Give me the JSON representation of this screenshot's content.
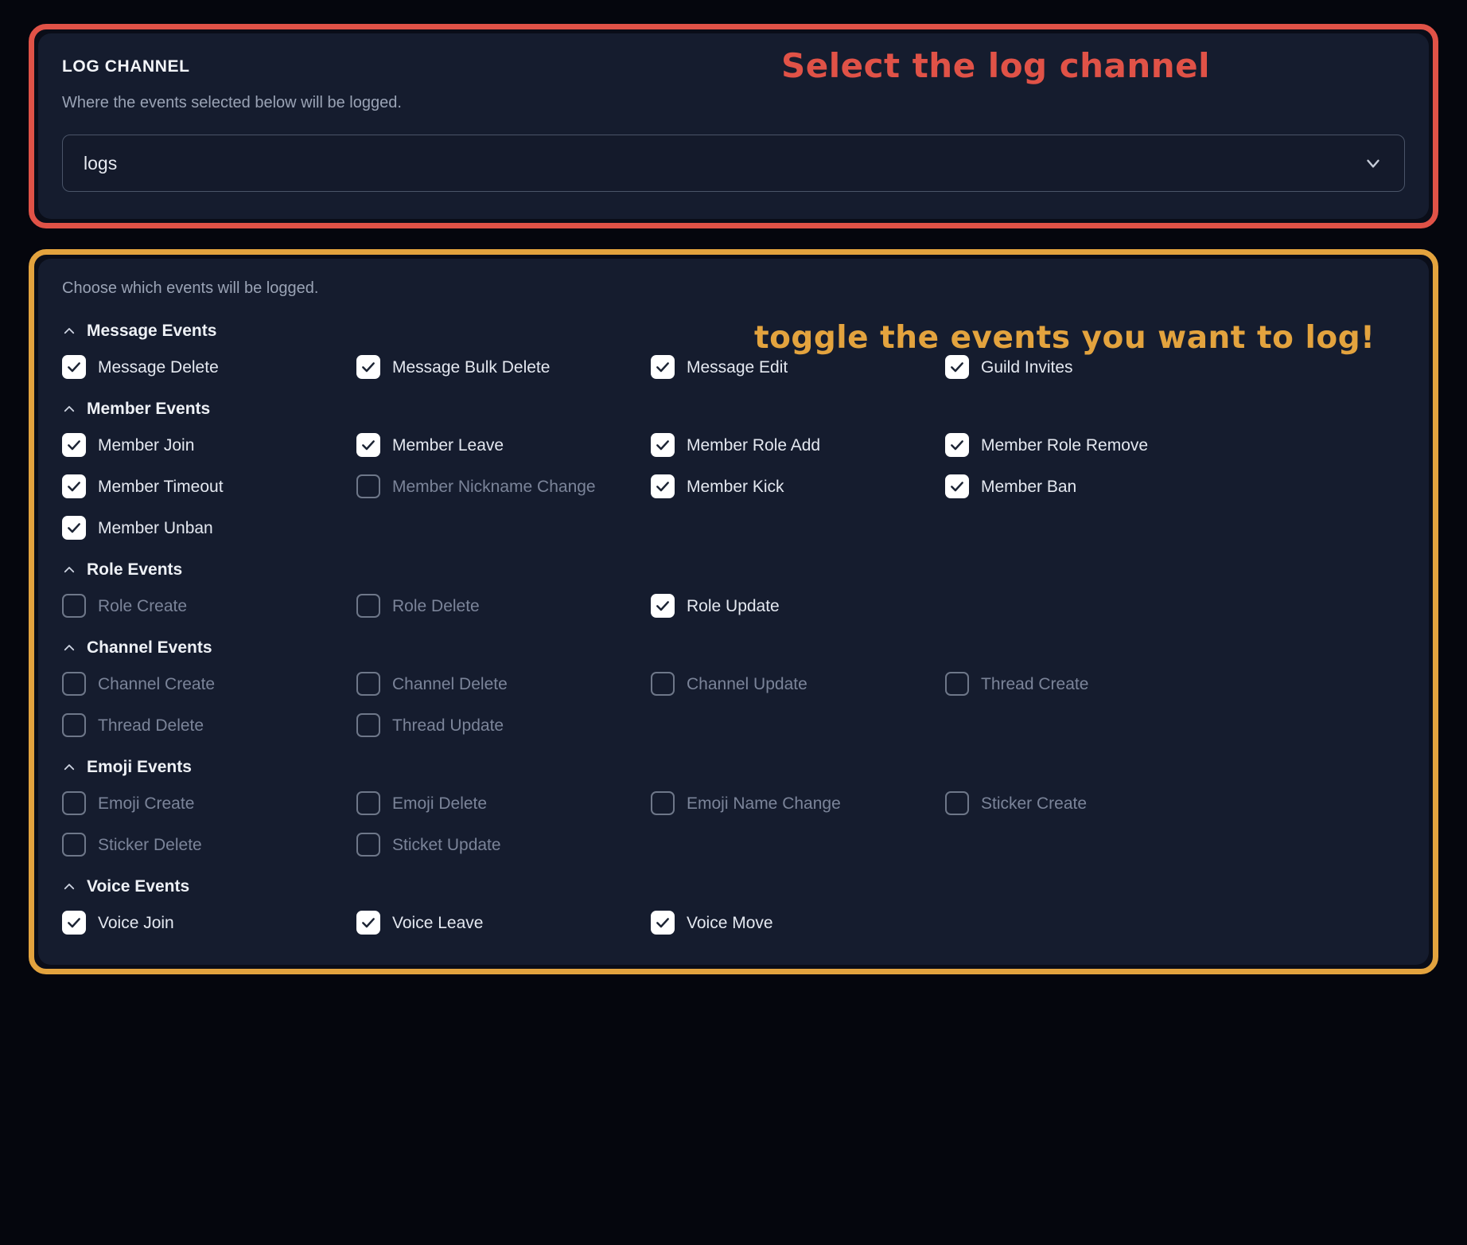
{
  "annotations": {
    "log_channel_note": "Select the log channel",
    "events_note": "toggle the events you want to log!",
    "red_color": "#e05247",
    "orange_color": "#e3a33e"
  },
  "log_channel": {
    "title": "LOG CHANNEL",
    "description": "Where the events selected below will be logged.",
    "select": {
      "value": "logs",
      "icon": "chevron-down-icon"
    }
  },
  "events": {
    "description": "Choose which events will be logged.",
    "groups": [
      {
        "title": "Message Events",
        "caret": "chevron-up-icon",
        "options": [
          {
            "label": "Message Delete",
            "checked": true
          },
          {
            "label": "Message Bulk Delete",
            "checked": true
          },
          {
            "label": "Message Edit",
            "checked": true
          },
          {
            "label": "Guild Invites",
            "checked": true
          }
        ]
      },
      {
        "title": "Member Events",
        "caret": "chevron-up-icon",
        "options": [
          {
            "label": "Member Join",
            "checked": true
          },
          {
            "label": "Member Leave",
            "checked": true
          },
          {
            "label": "Member Role Add",
            "checked": true
          },
          {
            "label": "Member Role Remove",
            "checked": true
          },
          {
            "label": "Member Timeout",
            "checked": true
          },
          {
            "label": "Member Nickname Change",
            "checked": false
          },
          {
            "label": "Member Kick",
            "checked": true
          },
          {
            "label": "Member Ban",
            "checked": true
          },
          {
            "label": "Member Unban",
            "checked": true
          }
        ]
      },
      {
        "title": "Role Events",
        "caret": "chevron-up-icon",
        "options": [
          {
            "label": "Role Create",
            "checked": false
          },
          {
            "label": "Role Delete",
            "checked": false
          },
          {
            "label": "Role Update",
            "checked": true
          }
        ]
      },
      {
        "title": "Channel Events",
        "caret": "chevron-up-icon",
        "options": [
          {
            "label": "Channel Create",
            "checked": false
          },
          {
            "label": "Channel Delete",
            "checked": false
          },
          {
            "label": "Channel Update",
            "checked": false
          },
          {
            "label": "Thread Create",
            "checked": false
          },
          {
            "label": "Thread Delete",
            "checked": false
          },
          {
            "label": "Thread Update",
            "checked": false
          }
        ]
      },
      {
        "title": "Emoji Events",
        "caret": "chevron-up-icon",
        "options": [
          {
            "label": "Emoji Create",
            "checked": false
          },
          {
            "label": "Emoji Delete",
            "checked": false
          },
          {
            "label": "Emoji Name Change",
            "checked": false
          },
          {
            "label": "Sticker Create",
            "checked": false
          },
          {
            "label": "Sticker Delete",
            "checked": false
          },
          {
            "label": "Sticket Update",
            "checked": false
          }
        ]
      },
      {
        "title": "Voice Events",
        "caret": "chevron-up-icon",
        "options": [
          {
            "label": "Voice Join",
            "checked": true
          },
          {
            "label": "Voice Leave",
            "checked": true
          },
          {
            "label": "Voice Move",
            "checked": true
          }
        ]
      }
    ]
  }
}
